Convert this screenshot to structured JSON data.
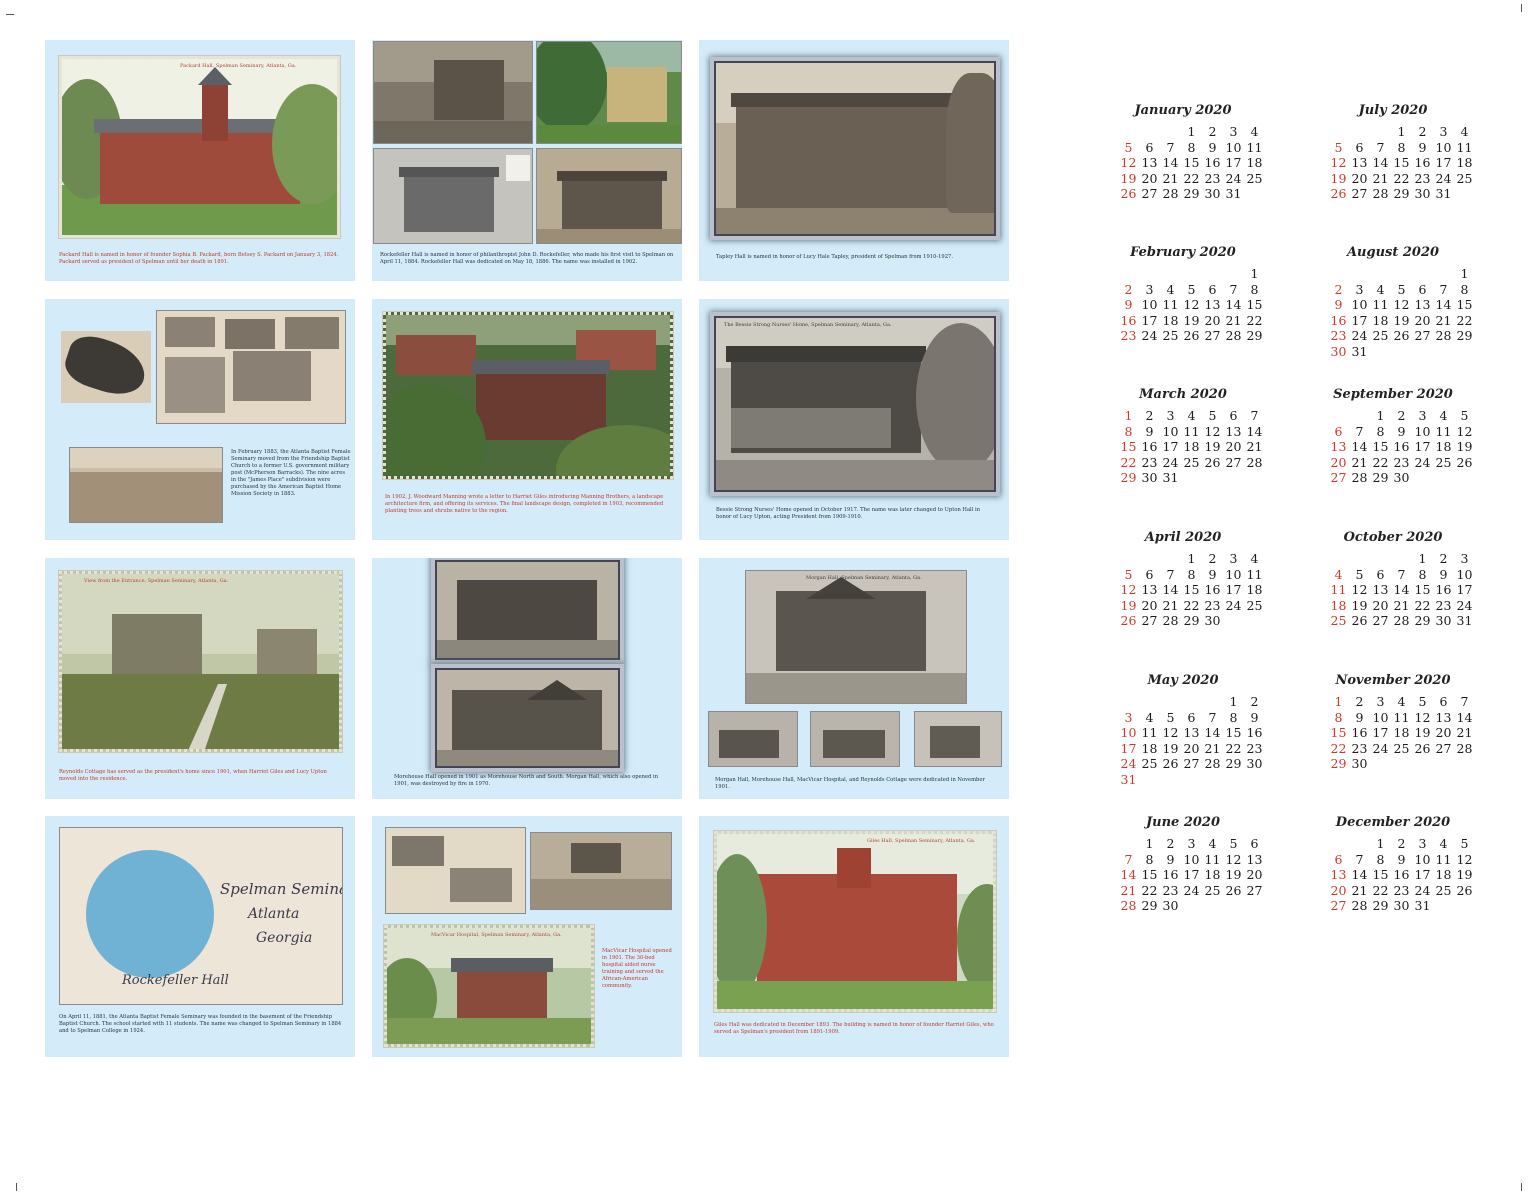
{
  "photo_panels": [
    {
      "captions": [
        "Packard Hall is named in honor of founder Sophia B. Packard, born Betsey S. Packard on January 3, 1824. Packard served as president of Spelman until her death in 1891."
      ],
      "photo_titles": [
        "Packard Hall, Spelman Seminary, Atlanta, Ga."
      ]
    },
    {
      "captions": [
        "Rockefeller Hall is named in honor of philanthropist John D. Rockefeller, who made his first visit to Spelman on April 11, 1884. Rockefeller Hall was dedicated on May 18, 1886. The name was installed in 1902."
      ],
      "photo_titles": []
    },
    {
      "captions": [
        "Tapley Hall is named in honor of Lucy Hale Tapley, president of Spelman from 1910-1927."
      ],
      "photo_titles": []
    },
    {
      "captions": [
        "In February 1883, the Atlanta Baptist Female Seminary moved from the Friendship Baptist Church to a former U.S. government military post (McPherson Barracks). The nine acres in the \"James Place\" subdivision were purchased by the American Baptist Home Mission Society in 1883."
      ],
      "photo_titles": []
    },
    {
      "captions": [
        "In 1902, J. Woodward Manning wrote a letter to Harriet Giles introducing Manning Brothers, a landscape architecture firm, and offering its services. The final landscape design, completed in 1903, recommended planting trees and shrubs native to the region."
      ],
      "photo_titles": []
    },
    {
      "captions": [
        "Bessie Strong Nurses' Home opened in October 1917. The name was later changed to Upton Hall in honor of Lucy Upton, acting President from 1909-1910."
      ],
      "photo_titles": [
        "The Bessie Strong Nurses' Home, Spelman Seminary, Atlanta, Ga."
      ]
    },
    {
      "captions": [
        "Reynolds Cottage has served as the president's home since 1901, when Harriet Giles and Lucy Upton moved into the residence."
      ],
      "photo_titles": [
        "View from the Entrance, Spelman Seminary, Atlanta, Ga."
      ]
    },
    {
      "captions": [
        "Morehouse Hall opened in 1901 as Morehouse North and South. Morgan Hall, which also opened in 1901, was destroyed by fire in 1970."
      ],
      "photo_titles": []
    },
    {
      "captions": [
        "Morgan Hall, Morehouse Hall, MacVicar Hospital, and Reynolds Cottage were dedicated in November 1901."
      ],
      "photo_titles": [
        "Morgan Hall, Spelman Seminary, Atlanta, Ga."
      ]
    },
    {
      "captions": [
        "On April 11, 1881, the Atlanta Baptist Female Seminary was founded in the basement of the Friendship Baptist Church. The school started with 11 students. The name was changed to Spelman Seminary in 1884 and to Spelman College in 1924."
      ],
      "photo_titles": [],
      "handwriting": [
        "Spelman Seminary",
        "Atlanta",
        "Georgia",
        "Rockefeller Hall"
      ]
    },
    {
      "captions": [
        "MacVicar Hospital opened in 1901. The 30-bed hospital aided nurse training and served the African-American community."
      ],
      "photo_titles": [
        "MacVicar Hospital, Spelman Seminary, Atlanta, Ga."
      ]
    },
    {
      "captions": [
        "Giles Hall was dedicated in December 1893. The building is named in honor of founder Harriet Giles, who served as Spelman's president from 1891-1909."
      ],
      "photo_titles": [
        "Giles Hall, Spelman Seminary, Atlanta, Ga."
      ]
    }
  ],
  "calendar": {
    "months": [
      {
        "title": "January 2020",
        "start": 3,
        "days": 31
      },
      {
        "title": "February 2020",
        "start": 6,
        "days": 29
      },
      {
        "title": "March 2020",
        "start": 0,
        "days": 31
      },
      {
        "title": "April 2020",
        "start": 3,
        "days": 30
      },
      {
        "title": "May 2020",
        "start": 5,
        "days": 31
      },
      {
        "title": "June 2020",
        "start": 1,
        "days": 30
      },
      {
        "title": "July 2020",
        "start": 3,
        "days": 31
      },
      {
        "title": "August 2020",
        "start": 6,
        "days": 31
      },
      {
        "title": "September 2020",
        "start": 2,
        "days": 30
      },
      {
        "title": "October 2020",
        "start": 4,
        "days": 31
      },
      {
        "title": "November 2020",
        "start": 0,
        "days": 30
      },
      {
        "title": "December 2020",
        "start": 2,
        "days": 31
      }
    ],
    "colors": {
      "sunday": "#cc3a2e",
      "weekday": "#1d1d1d",
      "panel_background": "#d4ecf9"
    }
  }
}
